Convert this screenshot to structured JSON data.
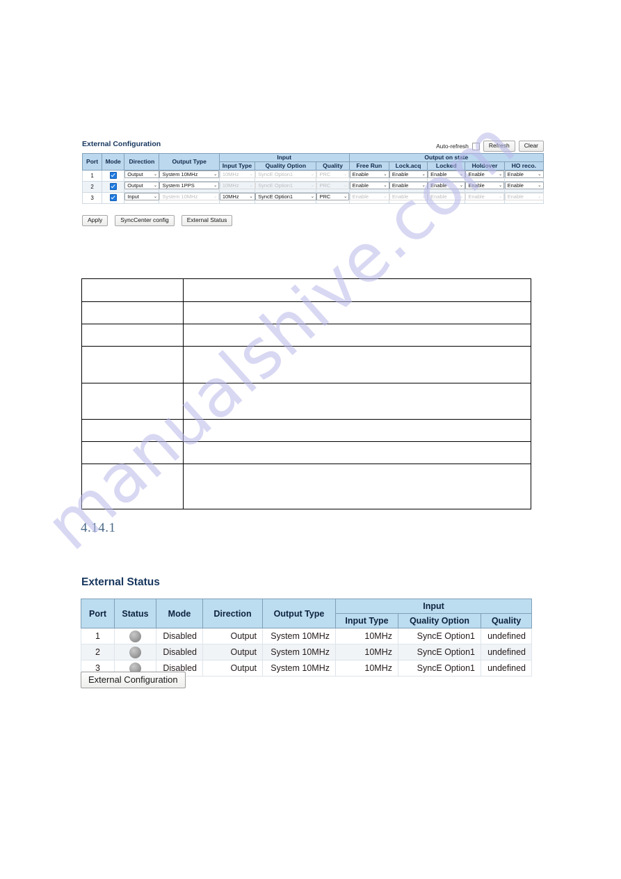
{
  "watermark": {
    "text": "manualshive.com"
  },
  "config_panel": {
    "title": "External Configuration",
    "auto_refresh_label": "Auto-refresh",
    "refresh_label": "Refresh",
    "clear_label": "Clear",
    "group_headers": {
      "input": "Input",
      "output_on_state": "Output on state"
    },
    "columns": {
      "port": "Port",
      "mode": "Mode",
      "direction": "Direction",
      "output_type": "Output Type",
      "input_type": "Input Type",
      "quality_option": "Quality Option",
      "quality": "Quality",
      "free_run": "Free Run",
      "lock_acq": "Lock.acq",
      "locked": "Locked",
      "holdover": "Holdover",
      "ho_reco": "HO reco."
    },
    "rows": [
      {
        "port": "1",
        "mode_checked": true,
        "direction": "Output",
        "direction_disabled": false,
        "output_type": "System 10MHz",
        "output_type_disabled": false,
        "input_type": "10MHz",
        "input_type_disabled": true,
        "quality_option": "SyncE Option1",
        "quality_option_disabled": true,
        "quality": "PRC",
        "quality_disabled": true,
        "free_run": "Enable",
        "free_run_disabled": false,
        "lock_acq": "Enable",
        "lock_acq_disabled": false,
        "locked": "Enable",
        "locked_disabled": false,
        "holdover": "Enable",
        "holdover_disabled": false,
        "ho_reco": "Enable",
        "ho_reco_disabled": false
      },
      {
        "port": "2",
        "mode_checked": true,
        "direction": "Output",
        "direction_disabled": false,
        "output_type": "System 1PPS",
        "output_type_disabled": false,
        "input_type": "10MHz",
        "input_type_disabled": true,
        "quality_option": "SyncE Option1",
        "quality_option_disabled": true,
        "quality": "PRC",
        "quality_disabled": true,
        "free_run": "Enable",
        "free_run_disabled": false,
        "lock_acq": "Enable",
        "lock_acq_disabled": false,
        "locked": "Enable",
        "locked_disabled": false,
        "holdover": "Enable",
        "holdover_disabled": false,
        "ho_reco": "Enable",
        "ho_reco_disabled": false
      },
      {
        "port": "3",
        "mode_checked": true,
        "direction": "Input",
        "direction_disabled": false,
        "output_type": "System 10MHz",
        "output_type_disabled": true,
        "input_type": "10MHz",
        "input_type_disabled": false,
        "quality_option": "SyncE Option1",
        "quality_option_disabled": false,
        "quality": "PRC",
        "quality_disabled": false,
        "free_run": "Enable",
        "free_run_disabled": true,
        "lock_acq": "Enable",
        "lock_acq_disabled": true,
        "locked": "Enable",
        "locked_disabled": true,
        "holdover": "Enable",
        "holdover_disabled": true,
        "ho_reco": "Enable",
        "ho_reco_disabled": true
      }
    ],
    "buttons": {
      "apply": "Apply",
      "synccenter": "SyncCenter config",
      "external_status": "External Status"
    }
  },
  "description_table": {
    "rows": [
      {
        "label": "",
        "text": "",
        "h": 33
      },
      {
        "label": "",
        "text": "",
        "h": 32
      },
      {
        "label": "",
        "text": "",
        "h": 32
      },
      {
        "label": "",
        "text": "",
        "h": 53
      },
      {
        "label": "",
        "text": "",
        "h": 52
      },
      {
        "label": "",
        "text": "",
        "h": 32
      },
      {
        "label": "",
        "text": "",
        "h": 32
      },
      {
        "label": "",
        "text": "",
        "h": 65
      }
    ]
  },
  "section_heading": {
    "number": "4.14.1"
  },
  "status_panel": {
    "title": "External Status",
    "group_headers": {
      "input": "Input"
    },
    "columns": {
      "port": "Port",
      "status": "Status",
      "mode": "Mode",
      "direction": "Direction",
      "output_type": "Output Type",
      "input_type": "Input Type",
      "quality_option": "Quality Option",
      "quality": "Quality"
    },
    "rows": [
      {
        "port": "1",
        "status_led": "gray-led",
        "mode": "Disabled",
        "direction": "Output",
        "output_type": "System 10MHz",
        "input_type": "10MHz",
        "quality_option": "SyncE Option1",
        "quality": "undefined"
      },
      {
        "port": "2",
        "status_led": "gray-led",
        "mode": "Disabled",
        "direction": "Output",
        "output_type": "System 10MHz",
        "input_type": "10MHz",
        "quality_option": "SyncE Option1",
        "quality": "undefined"
      },
      {
        "port": "3",
        "status_led": "gray-led",
        "mode": "Disabled",
        "direction": "Output",
        "output_type": "System 10MHz",
        "input_type": "10MHz",
        "quality_option": "SyncE Option1",
        "quality": "undefined"
      }
    ],
    "button": {
      "external_configuration": "External Configuration"
    }
  },
  "colors": {
    "table_header_blue": "#bcd8ef",
    "heading_navy": "#17375e",
    "section_heading_blue": "#4a6a86",
    "checkbox_blue": "#1f7ae0",
    "watermark_violet": "#b9b9ea",
    "row_alt": "#eef3f8"
  }
}
